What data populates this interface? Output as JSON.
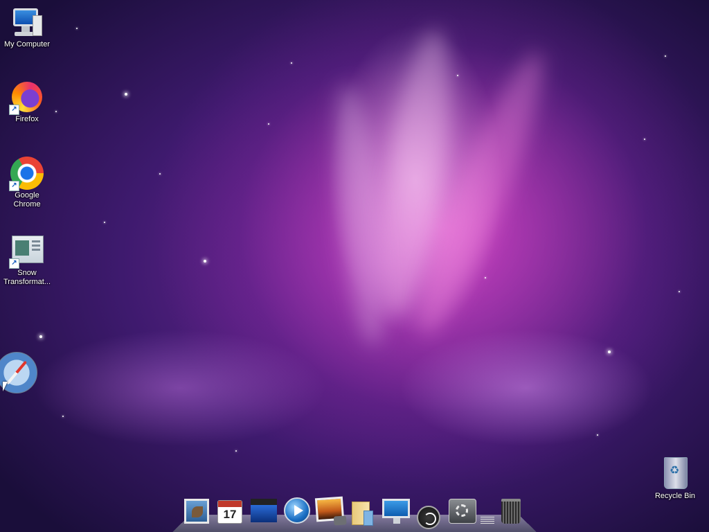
{
  "desktop": {
    "icons": [
      {
        "label": "My Computer",
        "icon": "my-computer-icon"
      },
      {
        "label": "Firefox",
        "icon": "firefox-icon"
      },
      {
        "label": "Google Chrome",
        "icon": "chrome-icon"
      },
      {
        "label": "Snow Transformat...",
        "icon": "snow-transformation-icon"
      },
      {
        "label": "Recycle Bin",
        "icon": "recycle-bin-icon"
      }
    ],
    "floating_icon": "safari-icon"
  },
  "dock": {
    "items": [
      {
        "name": "mail",
        "icon": "mail-stamp-icon"
      },
      {
        "name": "calendar",
        "icon": "calendar-icon",
        "text": "17"
      },
      {
        "name": "movie",
        "icon": "clapperboard-icon"
      },
      {
        "name": "media-player",
        "icon": "play-icon"
      },
      {
        "name": "photos",
        "icon": "photo-camera-icon"
      },
      {
        "name": "documents",
        "icon": "folder-icon"
      },
      {
        "name": "monitor",
        "icon": "monitor-icon"
      },
      {
        "name": "time-machine",
        "icon": "redo-arrow-icon"
      },
      {
        "name": "system-preferences",
        "icon": "gear-icon"
      },
      {
        "name": "trash",
        "icon": "trash-icon"
      }
    ]
  },
  "colors": {
    "wallpaper_primary": "#7a2a9e",
    "wallpaper_glow": "#dc46c8",
    "wallpaper_edge": "#1a0e3a",
    "label_text": "#ffffff"
  }
}
